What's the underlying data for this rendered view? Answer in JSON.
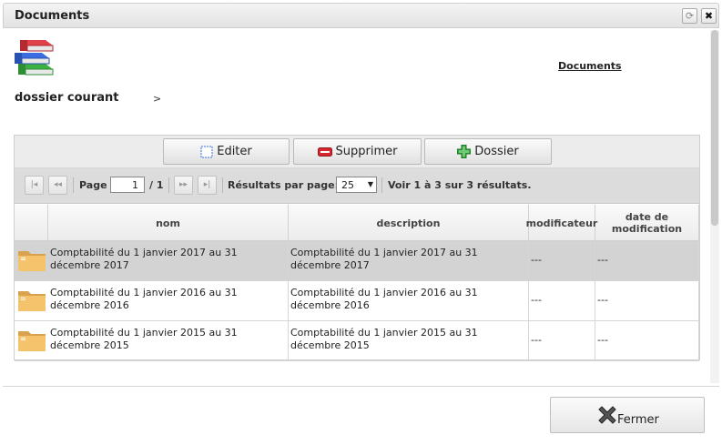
{
  "window": {
    "title": "Documents"
  },
  "header": {
    "documents_link": "Documents",
    "breadcrumb_label": "dossier courant",
    "breadcrumb_sep": ">"
  },
  "toolbar": {
    "edit_label": "Editer",
    "delete_label": "Supprimer",
    "folder_label": "Dossier"
  },
  "pager": {
    "page_label": "Page",
    "current_page": "1",
    "total_pages": "/ 1",
    "per_page_label": "Résultats par page:",
    "per_page_value": "25",
    "summary": "Voir 1 à 3 sur 3 résultats."
  },
  "grid": {
    "columns": [
      "nom",
      "description",
      "modificateur",
      "date de modification"
    ],
    "rows": [
      {
        "nom": "Comptabilité du 1 janvier 2017 au 31 décembre 2017",
        "description": "Comptabilité du 1 janvier 2017 au 31 décembre 2017",
        "modificateur": "---",
        "date": "---",
        "selected": true
      },
      {
        "nom": "Comptabilité du 1 janvier 2016 au 31 décembre 2016",
        "description": "Comptabilité du 1 janvier 2016 au 31 décembre 2016",
        "modificateur": "---",
        "date": "---",
        "selected": false
      },
      {
        "nom": "Comptabilité du 1 janvier 2015 au 31 décembre 2015",
        "description": "Comptabilité du 1 janvier 2015 au 31 décembre 2015",
        "modificateur": "---",
        "date": "---",
        "selected": false
      }
    ]
  },
  "footer": {
    "close_label": "Fermer"
  },
  "icons": {
    "books": "books-icon",
    "edit": "edit-icon",
    "delete": "delete-icon",
    "add_folder": "add-folder-icon",
    "folder": "folder-icon",
    "close": "close-icon"
  },
  "colors": {
    "selected_row": "#d3d3d3",
    "folder": "#f5c36b"
  }
}
